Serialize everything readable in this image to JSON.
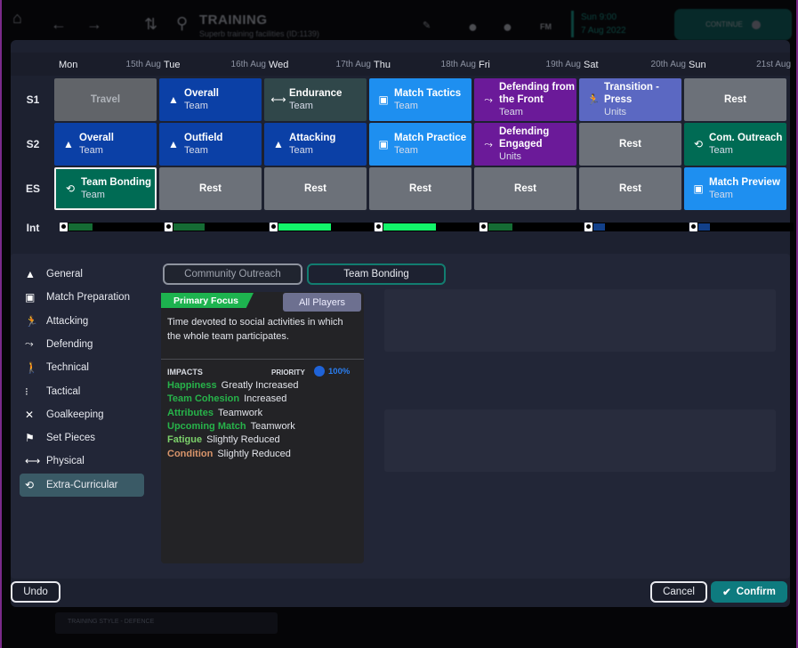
{
  "topbar": {
    "title": "TRAINING",
    "subtitle": "Superb training facilities (ID:1139)",
    "manager_initials": "FM",
    "date_line1": "Sun 9:00",
    "date_line2": "7 Aug 2022",
    "continue_label": "CONTINUE",
    "icons": {
      "home": "⌂",
      "back": "←",
      "forward": "→",
      "updown": "⇅",
      "search": "⚲",
      "edit": "✎",
      "globe": "●",
      "bulb": "●"
    }
  },
  "schedule": {
    "days": [
      {
        "name": "Mon",
        "date": "15th Aug"
      },
      {
        "name": "Tue",
        "date": "16th Aug"
      },
      {
        "name": "Wed",
        "date": "17th Aug"
      },
      {
        "name": "Thu",
        "date": "18th Aug"
      },
      {
        "name": "Fri",
        "date": "19th Aug"
      },
      {
        "name": "Sat",
        "date": "20th Aug"
      },
      {
        "name": "Sun",
        "date": "21st Aug"
      }
    ],
    "row_labels": [
      "S1",
      "S2",
      "ES",
      "Int"
    ],
    "rows": [
      [
        {
          "name": "Travel",
          "sub": "",
          "icon": ""
        },
        {
          "name": "Overall",
          "sub": "Team",
          "icon": "▲"
        },
        {
          "name": "Endurance",
          "sub": "Team",
          "icon": "⟷"
        },
        {
          "name": "Match Tactics",
          "sub": "Team",
          "icon": "▣"
        },
        {
          "name": "Defending from the Front",
          "sub": "Team",
          "icon": "⤳"
        },
        {
          "name": "Transition - Press",
          "sub": "Units",
          "icon": "🏃"
        },
        {
          "name": "Rest",
          "sub": "",
          "icon": ""
        }
      ],
      [
        {
          "name": "Overall",
          "sub": "Team",
          "icon": "▲"
        },
        {
          "name": "Outfield",
          "sub": "Team",
          "icon": "▲"
        },
        {
          "name": "Attacking",
          "sub": "Team",
          "icon": "▲"
        },
        {
          "name": "Match Practice",
          "sub": "Team",
          "icon": "▣"
        },
        {
          "name": "Defending Engaged",
          "sub": "Units",
          "icon": "⤳"
        },
        {
          "name": "Rest",
          "sub": "",
          "icon": ""
        },
        {
          "name": "Com. Outreach",
          "sub": "Team",
          "icon": "⟲"
        }
      ],
      [
        {
          "name": "Team Bonding",
          "sub": "Team",
          "icon": "⟲"
        },
        {
          "name": "Rest",
          "sub": "",
          "icon": ""
        },
        {
          "name": "Rest",
          "sub": "",
          "icon": ""
        },
        {
          "name": "Rest",
          "sub": "",
          "icon": ""
        },
        {
          "name": "Rest",
          "sub": "",
          "icon": ""
        },
        {
          "name": "Rest",
          "sub": "",
          "icon": ""
        },
        {
          "name": "Match Preview",
          "sub": "Team",
          "icon": "▣"
        }
      ]
    ],
    "intensity": [
      {
        "level": 0.25,
        "color": "#156b34"
      },
      {
        "level": 0.33,
        "color": "#156b34"
      },
      {
        "level": 0.55,
        "color": "#12f56a"
      },
      {
        "level": 0.55,
        "color": "#12f56a"
      },
      {
        "level": 0.25,
        "color": "#156b34"
      },
      {
        "level": 0.12,
        "color": "#12408a"
      },
      {
        "level": 0.12,
        "color": "#12408a"
      }
    ]
  },
  "sidebar": {
    "items": [
      {
        "label": "General",
        "icon": "▲"
      },
      {
        "label": "Match Preparation",
        "icon": "▣"
      },
      {
        "label": "Attacking",
        "icon": "🏃"
      },
      {
        "label": "Defending",
        "icon": "⤳"
      },
      {
        "label": "Technical",
        "icon": "🚶"
      },
      {
        "label": "Tactical",
        "icon": "⁝"
      },
      {
        "label": "Goalkeeping",
        "icon": "✕"
      },
      {
        "label": "Set Pieces",
        "icon": "⚑"
      },
      {
        "label": "Physical",
        "icon": "⟷"
      },
      {
        "label": "Extra-Curricular",
        "icon": "⟲"
      }
    ],
    "active_index": 9
  },
  "session_tabs": [
    "Community Outreach",
    "Team Bonding"
  ],
  "detail": {
    "primary_focus": "Primary Focus",
    "players": "All Players",
    "description": "Time devoted to social activities in which the whole team participates.",
    "impacts_label": "IMPACTS",
    "priority_label": "PRIORITY",
    "priority_value": "100%",
    "impacts": [
      {
        "key": "Happiness",
        "value": "Greatly Increased",
        "color": "#27b34a"
      },
      {
        "key": "Team Cohesion",
        "value": "Increased",
        "color": "#27b34a"
      },
      {
        "key": "Attributes",
        "value": "Teamwork",
        "color": "#27b34a"
      },
      {
        "key": "Upcoming Match",
        "value": "Teamwork",
        "color": "#27b34a"
      },
      {
        "key": "Fatigue",
        "value": "Slightly Reduced",
        "color": "#7cd16b"
      },
      {
        "key": "Condition",
        "value": "Slightly Reduced",
        "color": "#d8946a"
      }
    ]
  },
  "buttons": {
    "undo": "Undo",
    "cancel": "Cancel",
    "confirm": "Confirm",
    "confirm_icon": "✔"
  },
  "background": {
    "ghost_label": "TRAINING STYLE - DEFENCE"
  }
}
